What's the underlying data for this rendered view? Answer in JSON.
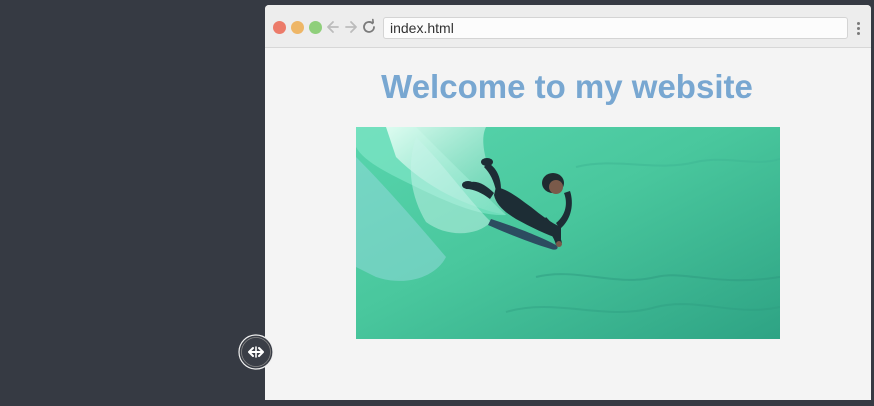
{
  "browser": {
    "address_text": "index.html",
    "icons": {
      "back": "arrow-left-icon",
      "forward": "arrow-right-icon",
      "reload": "reload-icon",
      "menu": "kebab-menu-icon"
    },
    "traffic_light_colors": [
      "#ec7b6a",
      "#eeb667",
      "#8fcf7b"
    ]
  },
  "page": {
    "heading": "Welcome to my website",
    "heading_color": "#78a7d1",
    "image": "surfer riding a wave on a bodyboard"
  },
  "desktop": {
    "background_color": "#363a43",
    "cursor": "horizontal-resize-cursor"
  }
}
